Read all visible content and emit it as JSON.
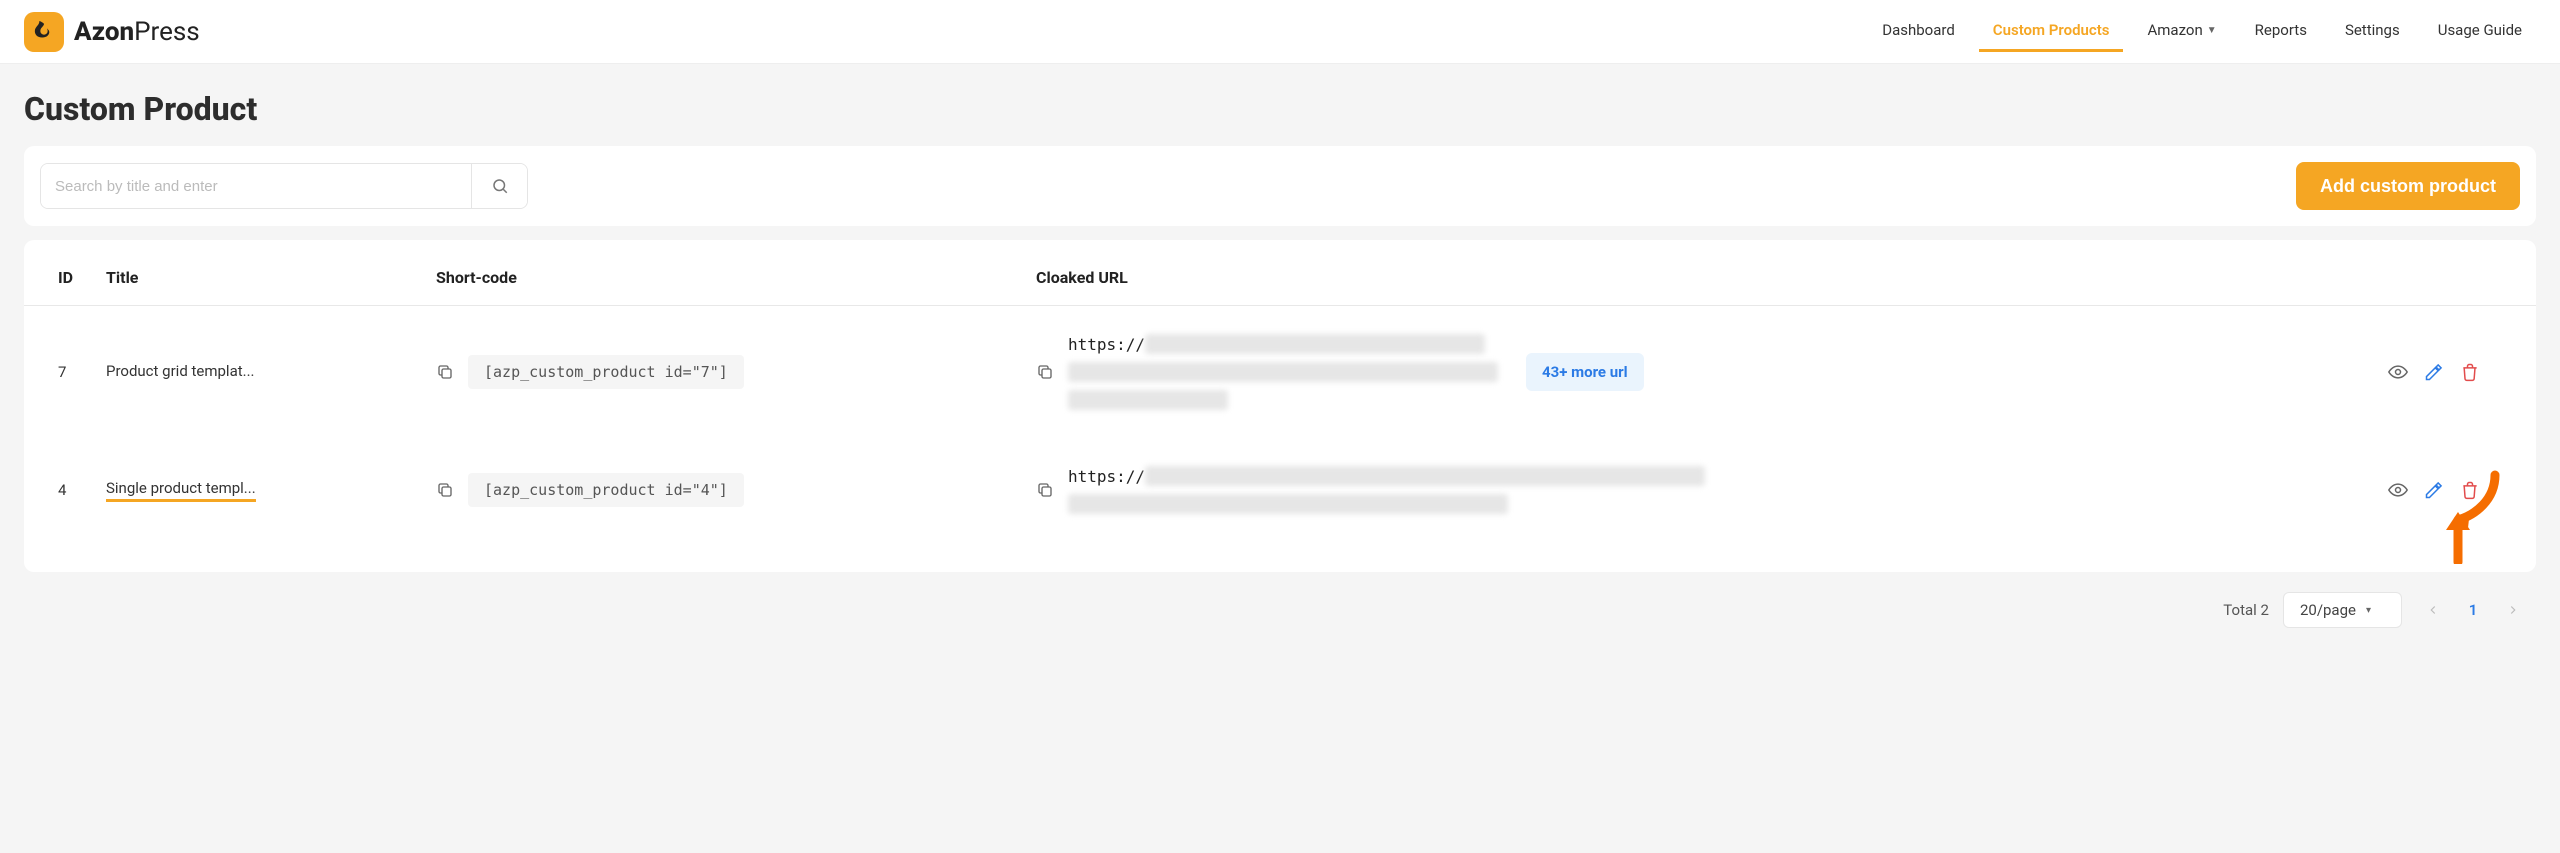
{
  "brand": {
    "bold": "Azon",
    "light": "Press"
  },
  "nav": {
    "dashboard": "Dashboard",
    "custom_products": "Custom Products",
    "amazon": "Amazon",
    "reports": "Reports",
    "settings": "Settings",
    "usage_guide": "Usage Guide"
  },
  "page": {
    "title": "Custom Product"
  },
  "toolbar": {
    "search_placeholder": "Search by title and enter",
    "add_button": "Add custom product"
  },
  "table": {
    "headers": {
      "id": "ID",
      "title": "Title",
      "short": "Short-code",
      "url": "Cloaked URL"
    },
    "rows": [
      {
        "id": "7",
        "title": "Product grid templat...",
        "highlight": false,
        "shortcode": "[azp_custom_product id=\"7\"]",
        "url_prefix": "https://",
        "more_url": "43+ more url",
        "has_more": true
      },
      {
        "id": "4",
        "title": "Single product templ...",
        "highlight": true,
        "shortcode": "[azp_custom_product id=\"4\"]",
        "url_prefix": "https://",
        "more_url": "",
        "has_more": false
      }
    ]
  },
  "footer": {
    "total_label": "Total 2",
    "page_size": "20/page",
    "current_page": "1"
  }
}
